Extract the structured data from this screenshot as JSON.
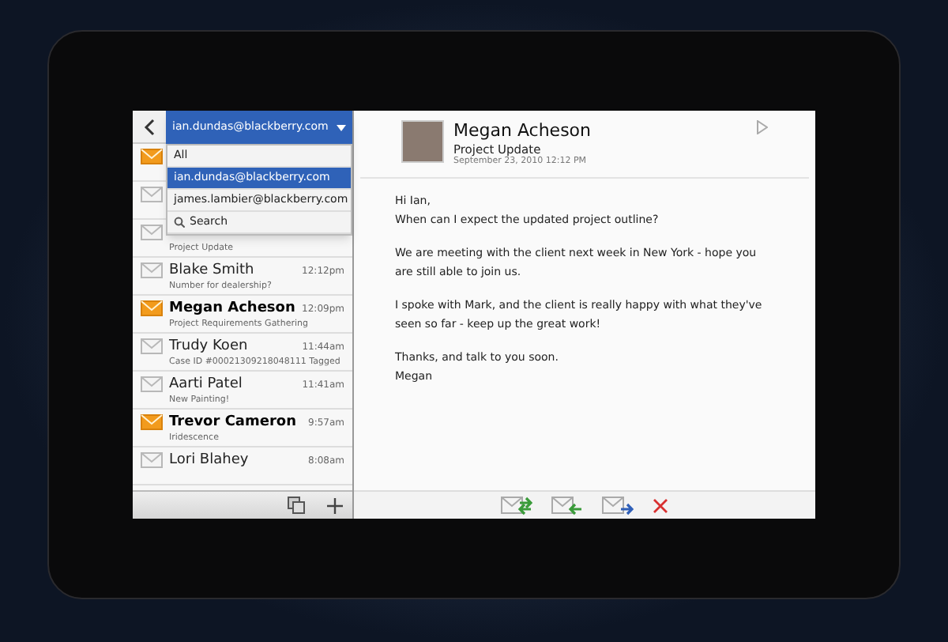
{
  "account_menu": {
    "current": "ian.dundas@blackberry.com",
    "expanded": true,
    "items": [
      {
        "kind": "option",
        "label": "All",
        "selected": false
      },
      {
        "kind": "option",
        "label": "ian.dundas@blackberry.com",
        "selected": true
      },
      {
        "kind": "option",
        "label": "james.lambier@blackberry.com",
        "selected": false
      },
      {
        "kind": "search",
        "label": "Search",
        "selected": false
      }
    ]
  },
  "messages": [
    {
      "unread": true
    },
    {
      "unread": false
    },
    {
      "unread": false,
      "subject": "Project Update"
    },
    {
      "unread": false,
      "sender": "Blake Smith",
      "time": "12:12pm",
      "subject": "Number for dealership?"
    },
    {
      "unread": true,
      "sender": "Megan Acheson",
      "time": "12:09pm",
      "subject": "Project Requirements Gathering"
    },
    {
      "unread": false,
      "sender": "Trudy Koen",
      "time": "11:44am",
      "subject": "Case ID #00021309218048111 Tagged"
    },
    {
      "unread": false,
      "sender": "Aarti Patel",
      "time": "11:41am",
      "subject": "New Painting!"
    },
    {
      "unread": true,
      "sender": "Trevor Cameron",
      "time": "9:57am",
      "subject": "Iridescence"
    },
    {
      "unread": false,
      "sender": "Lori Blahey",
      "time": "8:08am"
    }
  ],
  "email": {
    "sender": "Megan Acheson",
    "subject": "Project Update",
    "date": "September 23, 2010 12:12 PM",
    "body": [
      "Hi Ian,\nWhen can I expect the updated project outline?",
      "We are meeting with the client next week in New York - hope you are still able to join us.",
      "I spoke with Mark, and the client is really happy with what they've seen so far - keep up the great work!",
      "Thanks, and talk to you soon.\nMegan"
    ]
  }
}
